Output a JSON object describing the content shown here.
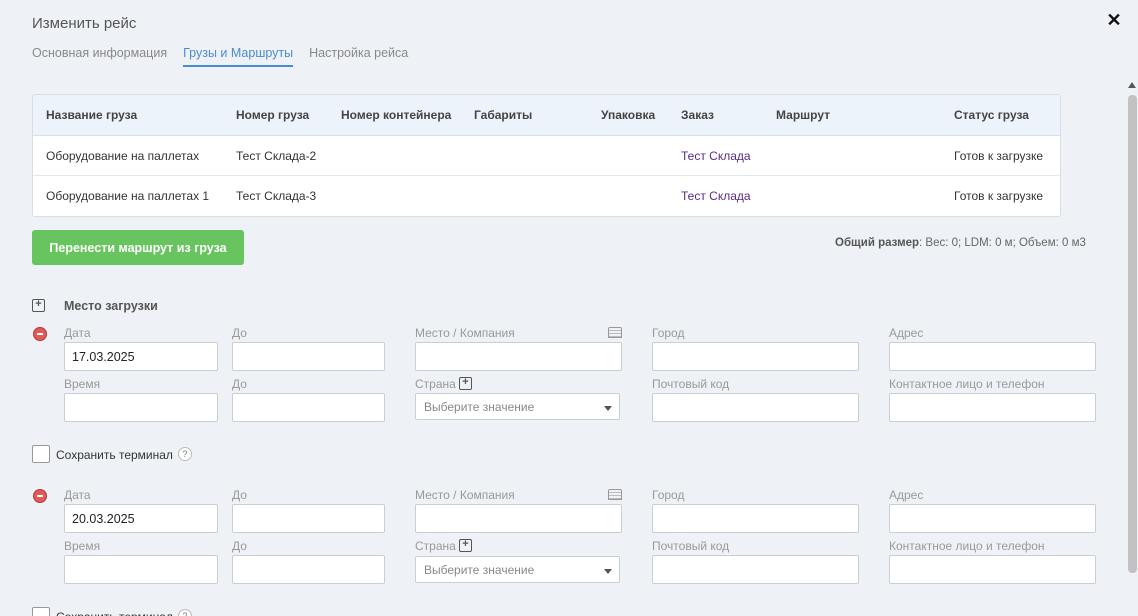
{
  "dialog": {
    "title": "Изменить рейс"
  },
  "tabs": [
    {
      "label": "Основная информация"
    },
    {
      "label": "Грузы и Маршруты"
    },
    {
      "label": "Настройка рейса"
    }
  ],
  "table": {
    "headers": [
      "Название груза",
      "Номер груза",
      "Номер контейнера",
      "Габариты",
      "Упаковка",
      "Заказ",
      "Маршрут",
      "Статус груза"
    ],
    "rows": [
      {
        "name": "Оборудование на паллетах",
        "number": "Тест Склада-2",
        "container": "",
        "dims": "",
        "packing": "",
        "order": "Тест Склада",
        "route": "",
        "status": "Готов к загрузке"
      },
      {
        "name": "Оборудование на паллетах 1",
        "number": "Тест Склада-3",
        "container": "",
        "dims": "",
        "packing": "",
        "order": "Тест Склада",
        "route": "",
        "status": "Готов к загрузке"
      }
    ]
  },
  "transfer_button": "Перенести маршрут из груза",
  "summary": {
    "label": "Общий размер",
    "text": ": Вес: 0;  LDM: 0 м;  Объем: 0 м3"
  },
  "section": {
    "title": "Место загрузки"
  },
  "labels": {
    "date": "Дата",
    "to": "До",
    "place": "Место / Компания",
    "city": "Город",
    "address": "Адрес",
    "time": "Время",
    "country": "Страна",
    "postal": "Почтовый код",
    "contact": "Контактное лицо и телефон",
    "save_terminal": "Сохранить терминал"
  },
  "stops": [
    {
      "date": "17.03.2025",
      "country_placeholder": "Выберите значение"
    },
    {
      "date": "20.03.2025",
      "country_placeholder": "Выберите значение"
    }
  ],
  "icons": {
    "close": "close-icon",
    "add": "plus-icon",
    "remove": "minus-circle-icon",
    "building": "building-icon",
    "help": "question-icon"
  },
  "colors": {
    "accent": "#4a8ccf",
    "green_button": "#67c45e",
    "link": "#5b2a86",
    "remove": "#e05a5a"
  }
}
